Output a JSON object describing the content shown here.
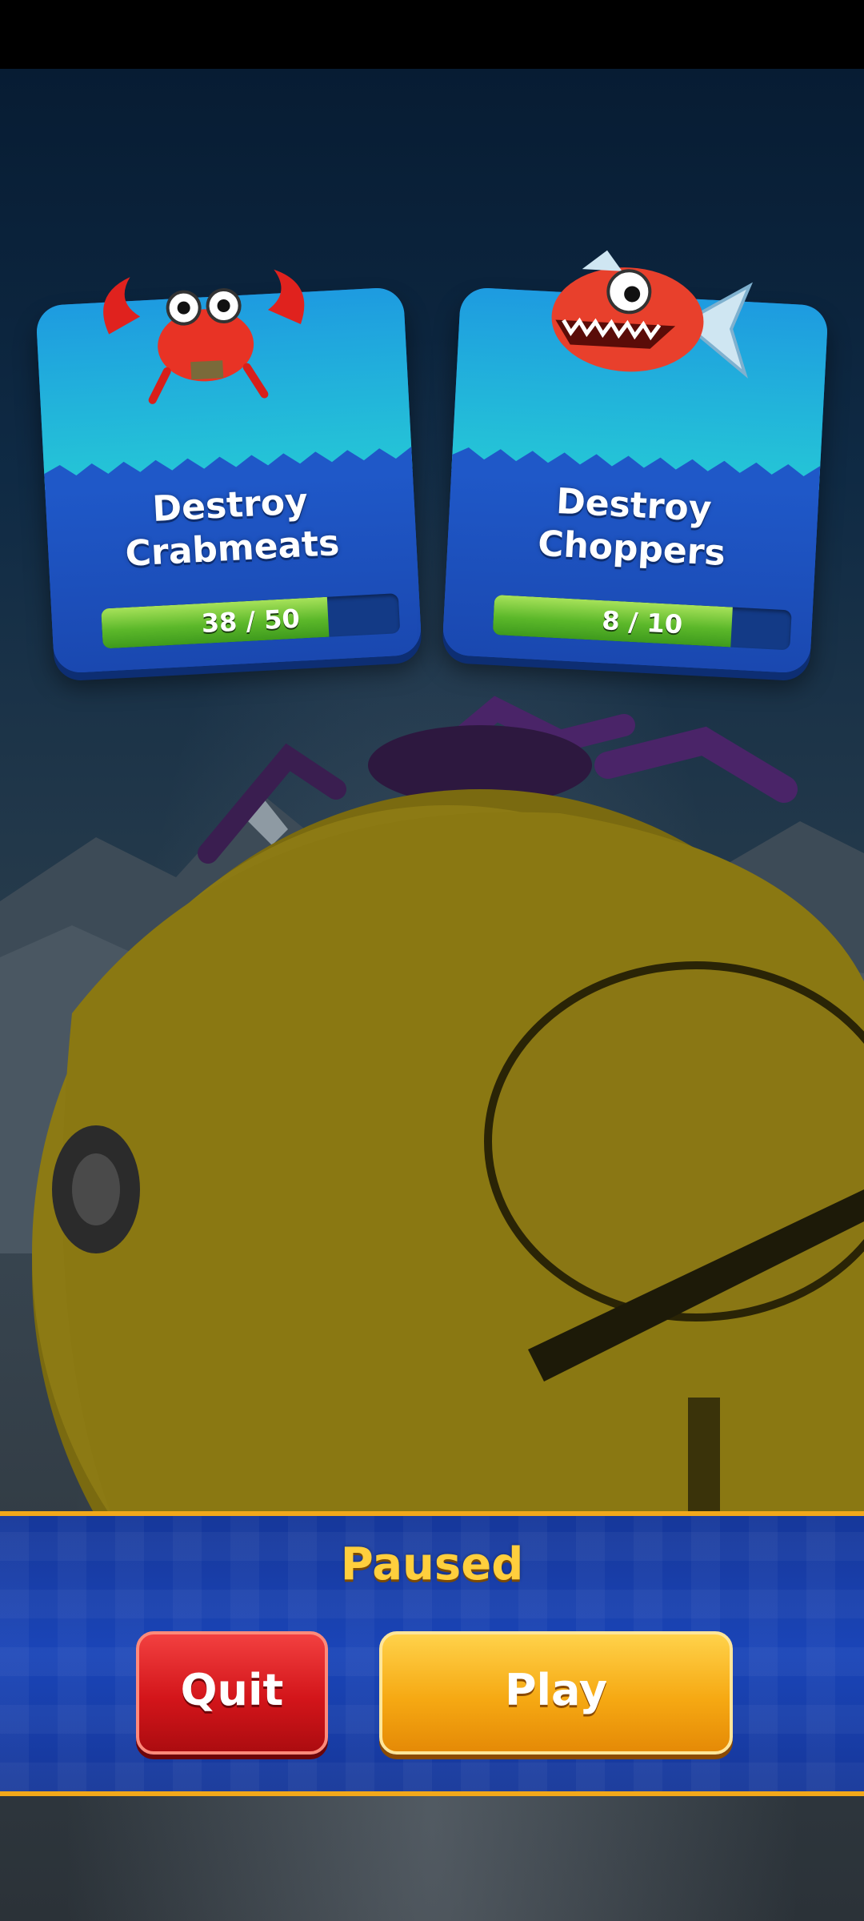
{
  "missions": [
    {
      "title_line1": "Destroy",
      "title_line2": "Crabmeats",
      "progress_text": "38 / 50",
      "progress_current": 38,
      "progress_total": 50,
      "icon": "crabmeat-icon"
    },
    {
      "title_line1": "Destroy",
      "title_line2": "Choppers",
      "progress_text": "8 / 10",
      "progress_current": 8,
      "progress_total": 10,
      "icon": "chopper-fish-icon"
    }
  ],
  "pause_menu": {
    "title": "Paused",
    "quit_label": "Quit",
    "play_label": "Play"
  },
  "colors": {
    "panel_blue": "#1a45b8",
    "panel_border": "#f2a81a",
    "quit_red": "#d3151a",
    "play_orange": "#f6a913",
    "progress_green": "#5cb82a"
  }
}
